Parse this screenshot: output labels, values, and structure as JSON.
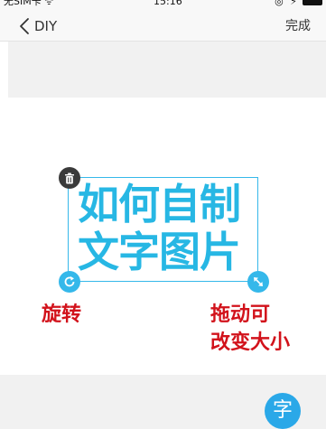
{
  "status_bar": {
    "carrier": "无SIM卡 ᯤ",
    "time": "15:16",
    "icons": "◎ ⚡"
  },
  "nav": {
    "back_label": "DIY",
    "done_label": "完成"
  },
  "sticker": {
    "line1": "如何自制",
    "line2": "文字图片",
    "text_color": "#27b7e4",
    "border_color": "#35b8ea"
  },
  "annotations": {
    "rotate": "旋转",
    "drag_line1": "拖动可",
    "drag_line2": "改变大小",
    "color": "#d2121b"
  },
  "toolbar": {
    "text_tool_label": "字"
  },
  "icons": {
    "back": "chevron-left-icon",
    "delete": "trash-icon",
    "rotate": "rotate-icon",
    "resize": "resize-arrows-icon"
  }
}
